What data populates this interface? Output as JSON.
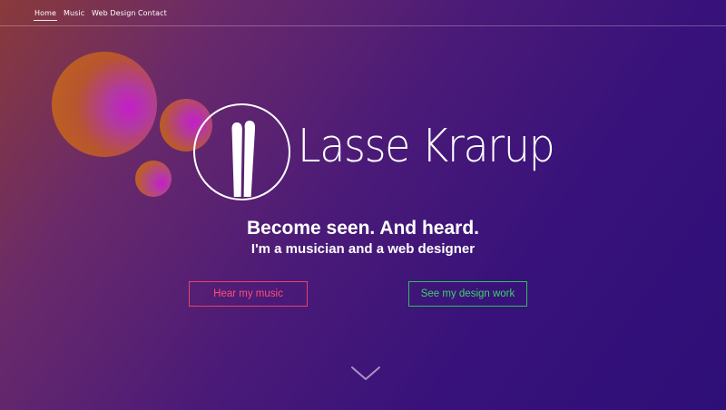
{
  "nav": {
    "items": [
      {
        "label": "Home",
        "active": true
      },
      {
        "label": "Music",
        "active": false
      },
      {
        "label": "Web Design",
        "active": false
      },
      {
        "label": "Contact",
        "active": false
      }
    ]
  },
  "hero": {
    "logo_icon": "drumsticks-icon",
    "logo_name": "Lasse Krarup",
    "headline": "Become seen. And heard.",
    "subheadline": "I'm a musician and a web designer"
  },
  "buttons": {
    "music_label": "Hear my music",
    "design_label": "See my design work"
  },
  "scroll_icon": "chevron-down-icon",
  "colors": {
    "music_button": "#ff4f78",
    "design_button": "#3bd26a",
    "bubble_outer": "#c0661e",
    "bubble_center": "#c020c0"
  }
}
